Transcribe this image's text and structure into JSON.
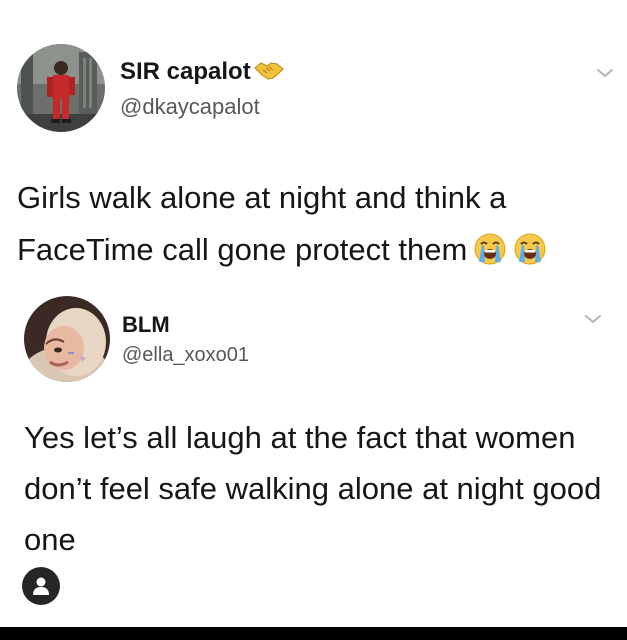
{
  "tweet1": {
    "display_name": "SIR capalot",
    "handle": "@dkaycapalot",
    "text": "Girls walk alone at night and think a FaceTime call gone protect them",
    "name_icon": "handshake-emoji",
    "text_emojis": [
      "loudly-crying-face",
      "loudly-crying-face"
    ]
  },
  "tweet2": {
    "display_name": "BLM",
    "handle": "@ella_xoxo01",
    "text": "Yes let’s all laugh at the fact that women don’t feel safe walking alone at night good one"
  },
  "colors": {
    "text": "#14171a",
    "secondary_text": "#55585c",
    "caret": "#aab8c2",
    "profile_button": "#262626",
    "bottom_bar": "#000000"
  },
  "icons": {
    "menu_caret": "chevron-down-icon",
    "profile": "user-icon"
  }
}
